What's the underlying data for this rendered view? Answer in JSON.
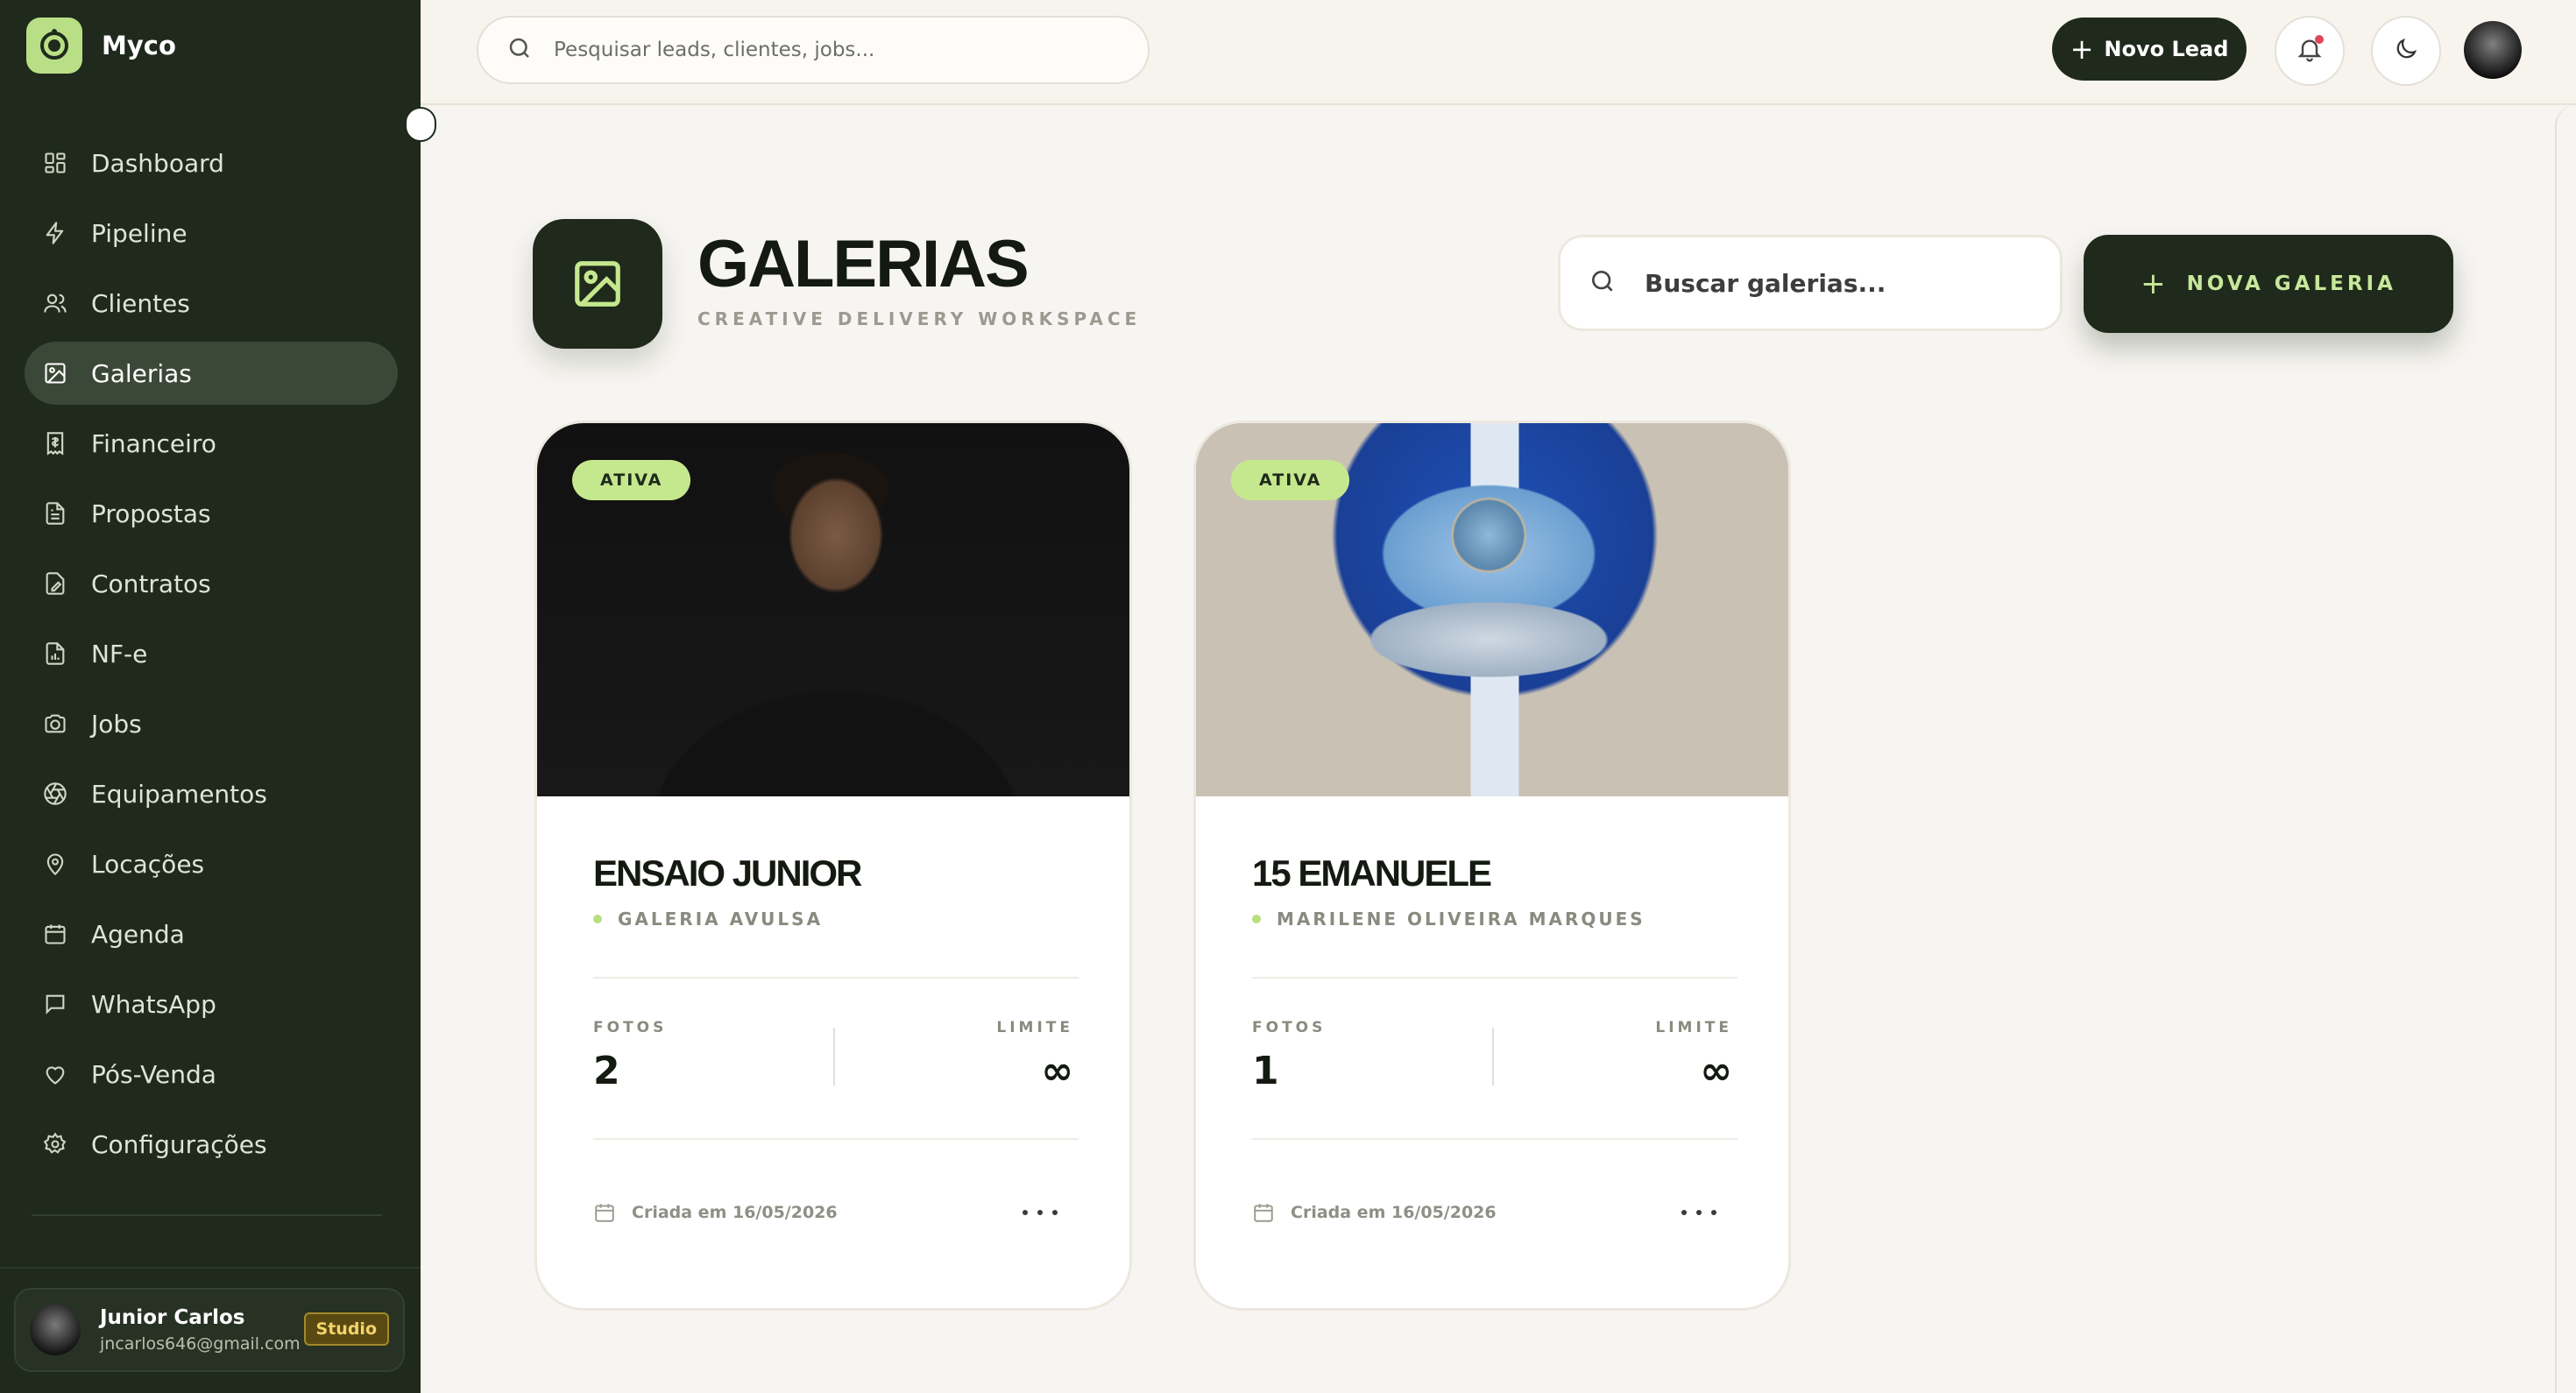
{
  "app": {
    "name": "Myco"
  },
  "sidebar": {
    "items": [
      {
        "label": "Dashboard",
        "icon": "dashboard-icon",
        "active": false
      },
      {
        "label": "Pipeline",
        "icon": "lightning-icon",
        "active": false
      },
      {
        "label": "Clientes",
        "icon": "users-icon",
        "active": false
      },
      {
        "label": "Galerias",
        "icon": "image-icon",
        "active": true
      },
      {
        "label": "Financeiro",
        "icon": "receipt-icon",
        "active": false
      },
      {
        "label": "Propostas",
        "icon": "document-icon",
        "active": false
      },
      {
        "label": "Contratos",
        "icon": "signature-icon",
        "active": false
      },
      {
        "label": "NF-e",
        "icon": "invoice-icon",
        "active": false
      },
      {
        "label": "Jobs",
        "icon": "camera-icon",
        "active": false
      },
      {
        "label": "Equipamentos",
        "icon": "aperture-icon",
        "active": false
      },
      {
        "label": "Locações",
        "icon": "map-pin-icon",
        "active": false
      },
      {
        "label": "Agenda",
        "icon": "calendar-icon",
        "active": false
      },
      {
        "label": "WhatsApp",
        "icon": "chat-icon",
        "active": false
      },
      {
        "label": "Pós-Venda",
        "icon": "heart-icon",
        "active": false
      },
      {
        "label": "Configurações",
        "icon": "gear-icon",
        "active": false
      }
    ],
    "user": {
      "name": "Junior Carlos",
      "email": "jncarlos646@gmail.com",
      "plan": "Studio"
    }
  },
  "topbar": {
    "search_placeholder": "Pesquisar leads, clientes, jobs...",
    "new_lead_label": "Novo Lead",
    "has_notification": true
  },
  "page": {
    "title": "GALERIAS",
    "subtitle": "CREATIVE DELIVERY WORKSPACE",
    "search_placeholder": "Buscar galerias...",
    "new_gallery_label": "NOVA GALERIA"
  },
  "galleries": [
    {
      "status": "ATIVA",
      "title": "ENSAIO JUNIOR",
      "client": "GALERIA AVULSA",
      "photos_label": "FOTOS",
      "photos": "2",
      "limit_label": "LIMITE",
      "limit": "∞",
      "created": "Criada em 16/05/2026"
    },
    {
      "status": "ATIVA",
      "title": "15 EMANUELE",
      "client": "MARILENE OLIVEIRA MARQUES",
      "photos_label": "FOTOS",
      "photos": "1",
      "limit_label": "LIMITE",
      "limit": "∞",
      "created": "Criada em 16/05/2026"
    }
  ],
  "colors": {
    "sidebar_bg": "#1f2a1c",
    "accent": "#c5e88e",
    "page_bg": "#f7f5f1",
    "notification": "#e0455a"
  }
}
